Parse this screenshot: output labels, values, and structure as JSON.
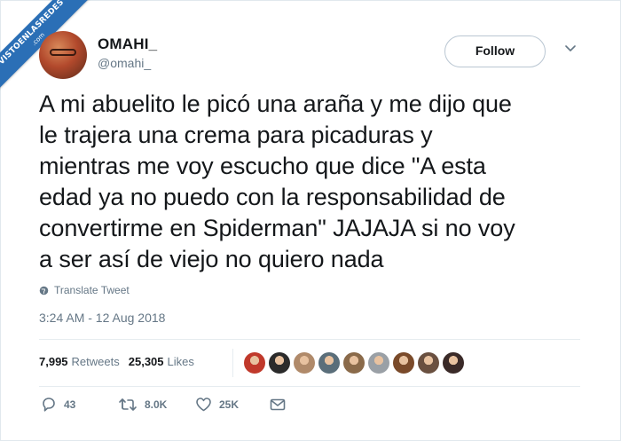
{
  "watermark": {
    "line1": "VISTOENLASREDES",
    "line2": ".com"
  },
  "author": {
    "name": "OMAHI_",
    "handle": "@omahi_"
  },
  "follow_label": "Follow",
  "tweet": {
    "text": "A mi abuelito le picó una araña y me dijo que\nle trajera una crema para picaduras y\nmientras me voy escucho que dice \"A esta\nedad ya no puedo con la responsabilidad de\nconvertirme en Spiderman\" JAJAJA si no voy\na ser así de viejo no quiero nada",
    "translate_label": "Translate Tweet",
    "timestamp": "3:24 AM - 12 Aug 2018"
  },
  "stats": {
    "retweets_count": "7,995",
    "retweets_label": "Retweets",
    "likes_count": "25,305",
    "likes_label": "Likes"
  },
  "liker_avatars": [
    {
      "icon": "avatar-red",
      "color": "#c0392b"
    },
    {
      "icon": "avatar-dark",
      "color": "#2b2b2b"
    },
    {
      "icon": "avatar-tan",
      "color": "#b08a6a"
    },
    {
      "icon": "avatar-group",
      "color": "#5a6e7a"
    },
    {
      "icon": "avatar-girl",
      "color": "#8a6a4a"
    },
    {
      "icon": "avatar-grey",
      "color": "#9aa0a6"
    },
    {
      "icon": "avatar-brown",
      "color": "#7a4a2a"
    },
    {
      "icon": "avatar-man",
      "color": "#6a5040"
    },
    {
      "icon": "avatar-dark2",
      "color": "#3a2a28"
    }
  ],
  "actions": {
    "reply_count": "43",
    "retweet_count": "8.0K",
    "like_count": "25K"
  }
}
